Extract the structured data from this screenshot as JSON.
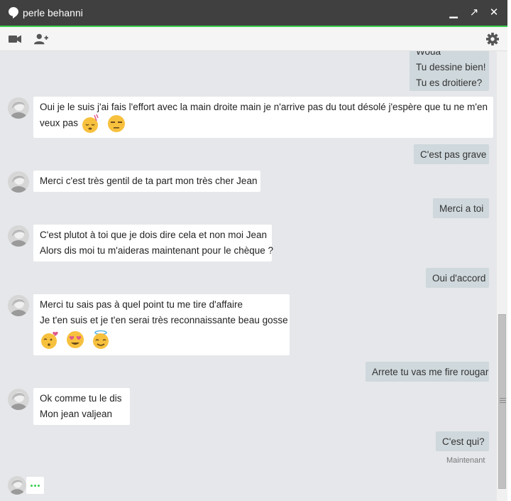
{
  "window": {
    "title": "perle behanni"
  },
  "titlebar_buttons": {
    "minimize": "▁",
    "popout": "↗",
    "close": "✕"
  },
  "toolbar": {
    "icons": [
      "video-camera-icon",
      "add-person-icon",
      "gear-icon"
    ]
  },
  "messages": [
    {
      "side": "out",
      "lines": [
        "Woua",
        "Tu dessine bien!",
        "Tu es droitiere?"
      ]
    },
    {
      "side": "in",
      "lines": [
        "Oui je le suis j'ai fais l'effort avec la main droite main je n'arrive pas du tout désolé j'espère que tu ne m'en",
        "veux pas"
      ],
      "emojis": [
        "sleepy-emoji",
        "unamused-emoji"
      ]
    },
    {
      "side": "out",
      "lines": [
        "C'est pas grave"
      ]
    },
    {
      "side": "in",
      "lines": [
        "Merci c'est très gentil de ta part mon très cher Jean"
      ]
    },
    {
      "side": "out",
      "lines": [
        "Merci a toi"
      ]
    },
    {
      "side": "in",
      "lines": [
        "C'est plutot à toi que je dois dire cela et non moi Jean",
        "Alors dis moi tu m'aideras maintenant pour le chèque ?"
      ]
    },
    {
      "side": "out",
      "lines": [
        "Oui d'accord"
      ]
    },
    {
      "side": "in",
      "lines": [
        "Merci tu sais pas à quel point tu me tire d'affaire",
        "Je t'en suis et je t'en serai très reconnaissante beau gosse"
      ],
      "emojis": [
        "kissing-heart-emoji",
        "heart-eyes-emoji",
        "halo-emoji"
      ]
    },
    {
      "side": "out",
      "lines": [
        "Arrete tu vas me fire rougar"
      ]
    },
    {
      "side": "in",
      "lines": [
        "Ok comme tu le dis",
        "Mon jean valjean"
      ]
    },
    {
      "side": "out",
      "lines": [
        "C'est qui?"
      ]
    }
  ],
  "timestamp": "Maintenant",
  "colors": {
    "accent": "#3ccf4e",
    "titlebar": "#404040",
    "outgoing_bubble": "#cfd8dc",
    "incoming_bubble": "#ffffff",
    "background": "#e5e7ea"
  }
}
